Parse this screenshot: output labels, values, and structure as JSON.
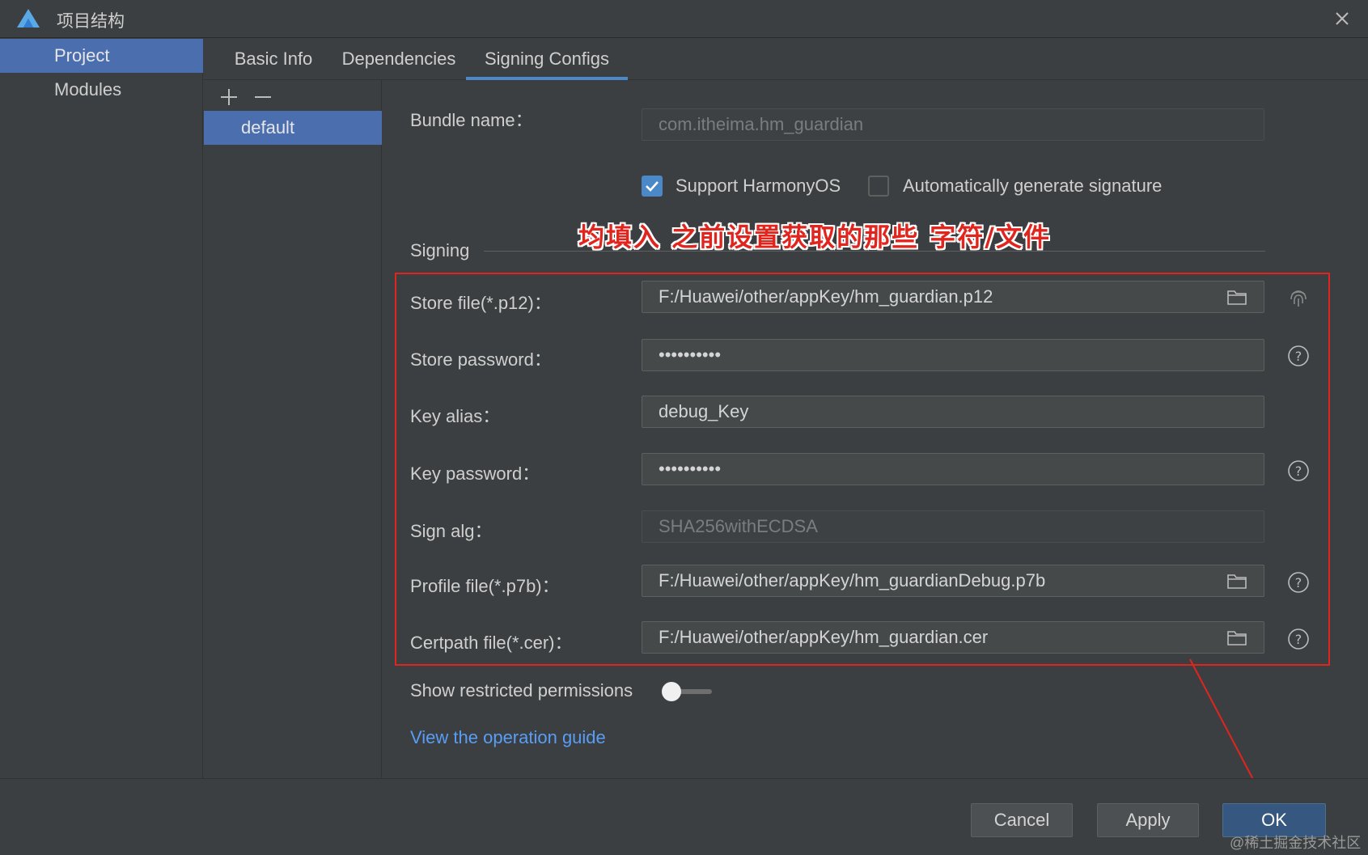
{
  "window": {
    "title": "项目结构",
    "logo_icon": "harmony-deveco-logo-icon",
    "close_icon": "close-icon"
  },
  "sidebar": {
    "items": [
      {
        "label": "Project",
        "active": true
      },
      {
        "label": "Modules",
        "active": false
      }
    ]
  },
  "tabs": [
    {
      "label": "Basic Info",
      "active": false
    },
    {
      "label": "Dependencies",
      "active": false
    },
    {
      "label": "Signing Configs",
      "active": true
    }
  ],
  "config_list": {
    "add_icon": "plus-icon",
    "remove_icon": "minus-icon",
    "items": [
      {
        "label": "default",
        "selected": true
      }
    ]
  },
  "form": {
    "bundle_name": {
      "label": "Bundle name：",
      "value": "com.itheima.hm_guardian"
    },
    "support_harmonyos": {
      "label": "Support HarmonyOS",
      "checked": true
    },
    "auto_signature": {
      "label": "Automatically generate signature",
      "checked": false
    },
    "section_title": "Signing",
    "store_file": {
      "label": "Store file(*.p12)：",
      "value": "F:/Huawei/other/appKey/hm_guardian.p12",
      "side_icon": "fingerprint-icon"
    },
    "store_password": {
      "label": "Store password：",
      "value": "••••••••••"
    },
    "key_alias": {
      "label": "Key alias：",
      "value": "debug_Key"
    },
    "key_password": {
      "label": "Key password：",
      "value": "••••••••••"
    },
    "sign_alg": {
      "label": "Sign alg：",
      "value": "SHA256withECDSA"
    },
    "profile_file": {
      "label": "Profile file(*.p7b)：",
      "value": "F:/Huawei/other/appKey/hm_guardianDebug.p7b"
    },
    "certpath_file": {
      "label": "Certpath file(*.cer)：",
      "value": "F:/Huawei/other/appKey/hm_guardian.cer"
    },
    "show_restricted": {
      "label": "Show restricted permissions",
      "on": false
    },
    "guide_link": "View the operation guide"
  },
  "annotation": {
    "text": "均填入 之前设置获取的那些 字符/文件",
    "color": "#e0251e"
  },
  "footer": {
    "cancel": "Cancel",
    "apply": "Apply",
    "ok": "OK"
  },
  "watermark": "@稀土掘金技术社区",
  "colors": {
    "background": "#3c3f41",
    "selection": "#4b6eaf",
    "accent": "#4a88c7",
    "link": "#589df6"
  }
}
